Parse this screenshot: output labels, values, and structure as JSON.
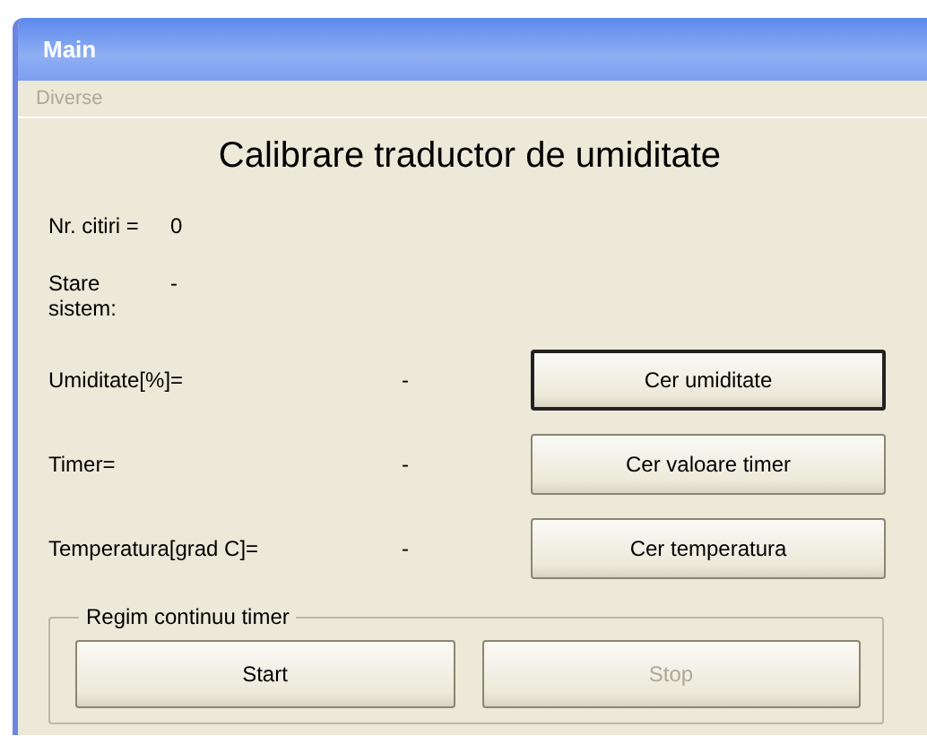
{
  "window": {
    "title": "Main"
  },
  "menu": [
    {
      "label": "Diverse",
      "disabled": true
    }
  ],
  "heading": "Calibrare traductor de umiditate",
  "info": [
    {
      "label": "Nr. citiri =",
      "value": "0"
    },
    {
      "label": "Stare sistem:",
      "value": "-"
    }
  ],
  "readings": [
    {
      "label": "Umiditate[%]=",
      "value": "-",
      "button": "Cer umiditate",
      "focused": true
    },
    {
      "label": "Timer=",
      "value": "-",
      "button": "Cer valoare timer",
      "focused": false
    },
    {
      "label": "Temperatura[grad C]=",
      "value": "-",
      "button": "Cer temperatura",
      "focused": false
    }
  ],
  "group": {
    "title": "Regim continuu timer",
    "buttons": [
      {
        "label": "Start",
        "disabled": false
      },
      {
        "label": "Stop",
        "disabled": true
      }
    ]
  }
}
